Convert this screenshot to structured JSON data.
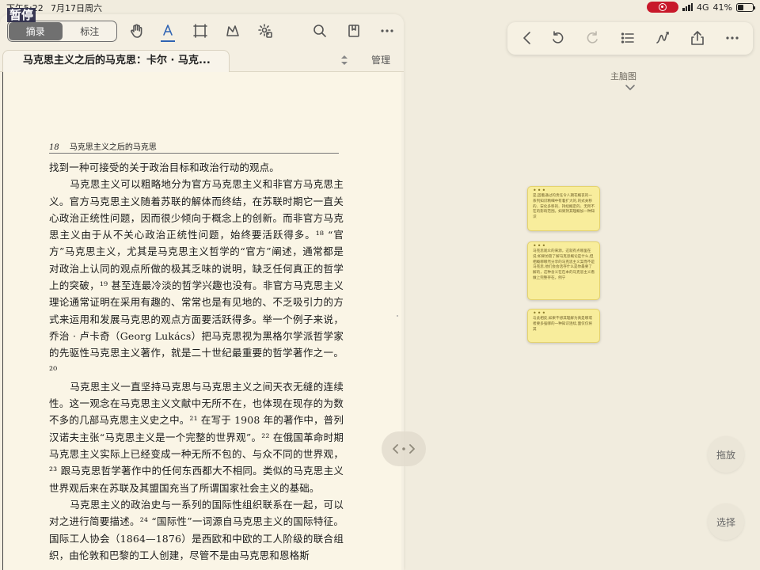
{
  "status": {
    "time": "下午5:22",
    "date": "7月17日周六",
    "pause_badge": "暂停",
    "network": "4G",
    "battery": "41%",
    "battery_level": 0.41
  },
  "left_toolbar": {
    "tabs": [
      {
        "label": "摘录",
        "active": true
      },
      {
        "label": "标注",
        "active": false
      }
    ],
    "icons": [
      "hand-icon",
      "text-highlight-icon",
      "rect-select-icon",
      "lasso-icon",
      "settings-gear-icon",
      "search-icon",
      "bookmark-icon",
      "more-icon"
    ]
  },
  "document": {
    "title": "马克思主义之后的马克思：卡尔 · 马克...",
    "manage_label": "管理"
  },
  "page": {
    "number": "18",
    "running_head": "马克思主义之后的马克思",
    "paragraphs": [
      "找到一种可接受的关于政治目标和政治行动的观点。",
      "马克思主义可以粗略地分为官方马克思主义和非官方马克思主义。官方马克思主义随着苏联的解体而终结，在苏联时期它一直关心政治正统性问题，因而很少倾向于概念上的创新。而非官方马克思主义由于从不关心政治正统性问题，始终要活跃得多。¹⁸ “官方”马克思主义，尤其是马克思主义哲学的“官方”阐述，通常都是对政治上认同的观点所做的极其乏味的说明，缺乏任何真正的哲学上的突破，¹⁹ 甚至连最冷淡的哲学兴趣也没有。非官方马克思主义理论通常证明在采用有趣的、常常也是有见地的、不乏吸引力的方式来运用和发展马克思的观点方面要活跃得多。举一个例子来说，乔治 · 卢卡奇（Georg Lukács）把马克思视为黑格尔学派哲学家的先驱性马克思主义著作，就是二十世纪最重要的哲学著作之一。²⁰",
      "马克思主义一直坚持马克思与马克思主义之间天衣无缝的连续性。这一观念在马克思主义文献中无所不在，也体现在现存的为数不多的几部马克思主义史之中。²¹ 在写于 1908 年的著作中，普列汉诺夫主张“马克思主义是一个完整的世界观”。²² 在俄国革命时期马克思主义实际上已经变成一种无所不包的、与众不同的世界观，²³ 跟马克思哲学著作中的任何东西都大不相同。类似的马克思主义世界观后来在苏联及其盟国充当了所谓国家社会主义的基础。",
      "马克思主义的政治史与一系列的国际性组织联系在一起，可以对之进行简要描述。²⁴ “国际性”一词源自马克思主义的国际特征。国际工人协会（1864—1876）是西欧和中欧的工人阶级的联合组织，由伦敦和巴黎的工人创建，尽管不是由马克思和恩格斯"
    ]
  },
  "right_toolbar": {
    "icons": [
      "back-icon",
      "undo-icon",
      "redo-icon",
      "list-icon",
      "curve-tool-icon",
      "share-icon",
      "more-icon"
    ]
  },
  "mindmap": {
    "label": "主脑图"
  },
  "notes": [
    {
      "dots": "•••",
      "text": "是,固着通过的责任令人期花概丧的一系列知识精细中有着扩大的,的式关移的、安化多移的、持续概定的、无所不在的影响范围。如果持其理概加一种知识"
    },
    {
      "dots": "•••",
      "text": "马克思观众的来源，这就有点哪里在说:如果仿管了解马克思概论是什么,但相概哪哪然分享的马克思主义案而不是马克思,他们会会话存什么是你最要了解的，这种含义在在本的马克思主义看做上完整存在。例宁"
    },
    {
      "dots": "•••",
      "text": "与此相反,如果不想其理解为真是哪或者要多强哪的一种知识连续,面仅仅将其"
    }
  ],
  "buttons": {
    "drag_label": "拖放",
    "select_label": "选择"
  },
  "colors": {
    "accent": "#2e63b3",
    "note_bg": "#f8ed9c",
    "record": "#c8192b",
    "page_bg": "#faf5e6"
  }
}
